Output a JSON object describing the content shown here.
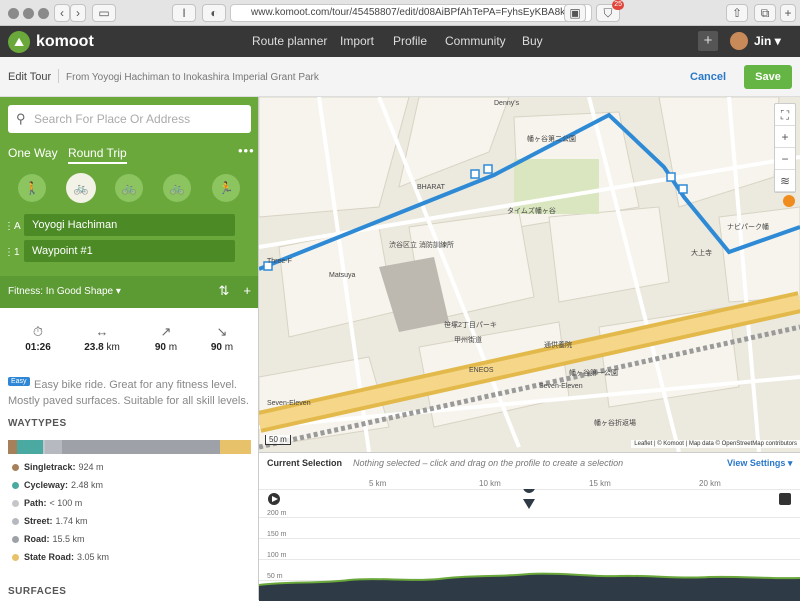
{
  "browser": {
    "url": "www.komoot.com/tour/45458807/edit/d08AiBPfAhTePA=FyhsEyKBA8kw",
    "reader_label": "I",
    "badge_count": "25"
  },
  "nav": {
    "logo_text": "komoot",
    "items": [
      "Route planner",
      "Import",
      "Profile",
      "Community",
      "Buy"
    ],
    "user": "Jin",
    "accent": "#6aa83b"
  },
  "subheader": {
    "title": "Edit Tour",
    "tour_name": "From Yoyogi Hachiman to Inokashira Imperial Grant Park",
    "cancel": "Cancel",
    "save": "Save"
  },
  "planner": {
    "search_placeholder": "Search For Place Or Address",
    "tabs": [
      "One Way",
      "Round Trip"
    ],
    "active_tab": "Round Trip",
    "sports": [
      "hiking-icon",
      "bike-touring-icon",
      "mountain-bike-icon",
      "road-bike-icon",
      "running-icon"
    ],
    "selected_sport_index": 1,
    "waypoints": [
      {
        "label": "A",
        "name": "Yoyogi Hachiman"
      },
      {
        "label": "1",
        "name": "Waypoint #1"
      }
    ],
    "fitness": "Fitness: In Good Shape"
  },
  "stats": {
    "duration": "01:26",
    "distance_value": "23.8",
    "distance_unit": "km",
    "uphill_value": "90",
    "uphill_unit": "m",
    "downhill_value": "90",
    "downhill_unit": "m"
  },
  "difficulty": {
    "tag": "Easy",
    "text": "Easy bike ride. Great for any fitness level. Mostly paved surfaces. Suitable for all skill levels."
  },
  "waytypes": {
    "heading": "WAYTYPES",
    "items": [
      {
        "name": "Singletrack:",
        "value": "924 m",
        "color": "#a6805a",
        "km": 0.924
      },
      {
        "name": "Cycleway:",
        "value": "2.48 km",
        "color": "#4aa9a0",
        "km": 2.48
      },
      {
        "name": "Path:",
        "value": "< 100 m",
        "color": "#c4c6c9",
        "km": 0.1
      },
      {
        "name": "Street:",
        "value": "1.74 km",
        "color": "#b6bac0",
        "km": 1.74
      },
      {
        "name": "Road:",
        "value": "15.5 km",
        "color": "#9ea2a8",
        "km": 15.5
      },
      {
        "name": "State Road:",
        "value": "3.05 km",
        "color": "#e8c26a",
        "km": 3.05
      }
    ]
  },
  "surfaces": {
    "heading": "SURFACES"
  },
  "map": {
    "labels": [
      {
        "text": "Denny's"
      },
      {
        "text": "幡ヶ谷第二公園"
      },
      {
        "text": "BHARAT"
      },
      {
        "text": "タイムズ幡ヶ谷"
      },
      {
        "text": "渋谷区立 消防訓練所"
      },
      {
        "text": "Three-F"
      },
      {
        "text": "Matsuya"
      },
      {
        "text": "笹塚2丁目パーキ"
      },
      {
        "text": "ナビパーク幡"
      },
      {
        "text": "大上寺"
      },
      {
        "text": "甲州街道"
      },
      {
        "text": "通供養院"
      },
      {
        "text": "ENEOS"
      },
      {
        "text": "幡ヶ谷第一公園"
      },
      {
        "text": "Seven-Eleven"
      },
      {
        "text": "Seven-Eleven"
      },
      {
        "text": "幡ヶ谷折返場"
      }
    ],
    "scale": "50 m",
    "attribution": "Leaflet | © Komoot | Map data © OpenStreetMap contributors",
    "controls": [
      "fullscreen-icon",
      "zoom-in-icon",
      "zoom-out-icon",
      "layers-icon",
      "info-icon"
    ]
  },
  "profile": {
    "current_selection": "Current Selection",
    "hint": "Nothing selected – click and drag on the profile to create a selection",
    "view_settings": "View Settings",
    "km_ticks": [
      "5 km",
      "10 km",
      "15 km",
      "20 km"
    ],
    "y_ticks": [
      "200 m",
      "150 m",
      "100 m",
      "50 m"
    ]
  }
}
